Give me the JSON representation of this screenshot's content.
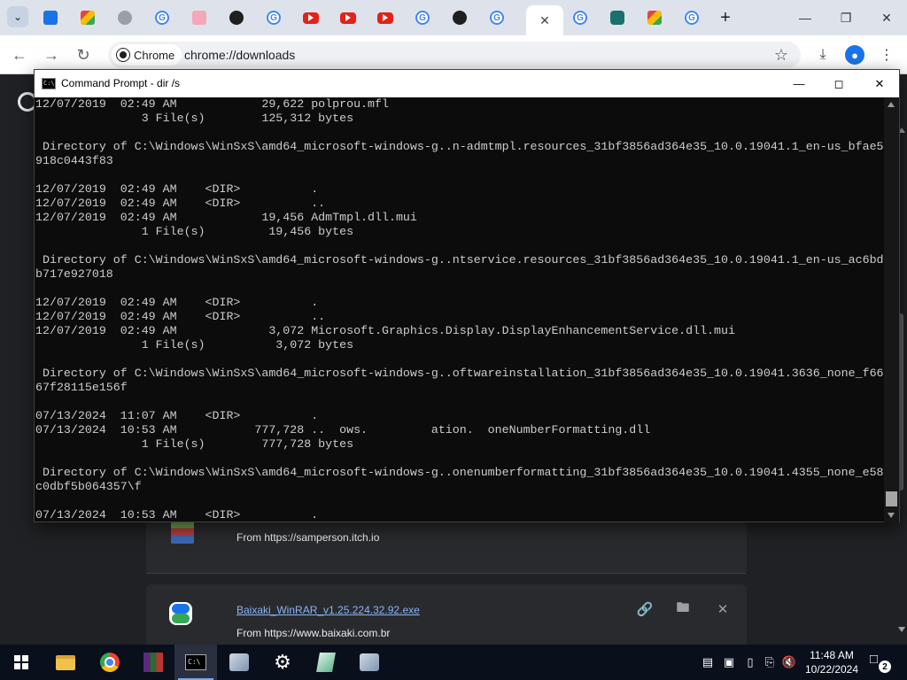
{
  "browser": {
    "tabs": [
      {
        "icon": "blue-app-icon"
      },
      {
        "icon": "drive-icon"
      },
      {
        "icon": "grey-circle-icon"
      },
      {
        "icon": "google-icon"
      },
      {
        "icon": "pink-app-icon"
      },
      {
        "icon": "github-icon"
      },
      {
        "icon": "google-icon"
      },
      {
        "icon": "youtube-icon"
      },
      {
        "icon": "youtube-icon"
      },
      {
        "icon": "youtube-icon"
      },
      {
        "icon": "google-icon"
      },
      {
        "icon": "github-icon"
      },
      {
        "icon": "google-icon"
      },
      {
        "icon": "close-icon",
        "active": true
      },
      {
        "icon": "google-icon"
      },
      {
        "icon": "teal-app-icon"
      },
      {
        "icon": "drive-icon"
      },
      {
        "icon": "google-icon"
      }
    ],
    "omnibox": {
      "chip_label": "Chrome",
      "url": "chrome://downloads"
    }
  },
  "cmd": {
    "title": "Command Prompt - dir /s",
    "lines": [
      "12/07/2019  02:49 AM            29,622 polprou.mfl",
      "               3 File(s)        125,312 bytes",
      "",
      " Directory of C:\\Windows\\WinSxS\\amd64_microsoft-windows-g..n-admtmpl.resources_31bf3856ad364e35_10.0.19041.1_en-us_bfae5",
      "918c0443f83",
      "",
      "12/07/2019  02:49 AM    <DIR>          .",
      "12/07/2019  02:49 AM    <DIR>          ..",
      "12/07/2019  02:49 AM            19,456 AdmTmpl.dll.mui",
      "               1 File(s)         19,456 bytes",
      "",
      " Directory of C:\\Windows\\WinSxS\\amd64_microsoft-windows-g..ntservice.resources_31bf3856ad364e35_10.0.19041.1_en-us_ac6bd",
      "b717e927018",
      "",
      "12/07/2019  02:49 AM    <DIR>          .",
      "12/07/2019  02:49 AM    <DIR>          ..",
      "12/07/2019  02:49 AM             3,072 Microsoft.Graphics.Display.DisplayEnhancementService.dll.mui",
      "               1 File(s)          3,072 bytes",
      "",
      " Directory of C:\\Windows\\WinSxS\\amd64_microsoft-windows-g..oftwareinstallation_31bf3856ad364e35_10.0.19041.3636_none_f66",
      "67f28115e156f",
      "",
      "07/13/2024  11:07 AM    <DIR>          .",
      "07/13/2024  10:53 AM           777,728 ..  ows.         ation.  oneNumberFormatting.dll",
      "               1 File(s)        777,728 bytes",
      "",
      " Directory of C:\\Windows\\WinSxS\\amd64_microsoft-windows-g..onenumberformatting_31bf3856ad364e35_10.0.19041.4355_none_e58",
      "c0dbf5b064357\\f",
      "",
      "07/13/2024  10:53 AM    <DIR>          ."
    ]
  },
  "downloads": {
    "items": [
      {
        "from": "From https://samperson.itch.io"
      },
      {
        "filename": "Baixaki_WinRAR_v1.25.224.32.92.exe",
        "from": "From https://www.baixaki.com.br"
      }
    ]
  },
  "taskbar": {
    "clock_time": "11:48 AM",
    "clock_date": "10/22/2024",
    "notification_count": "2"
  }
}
